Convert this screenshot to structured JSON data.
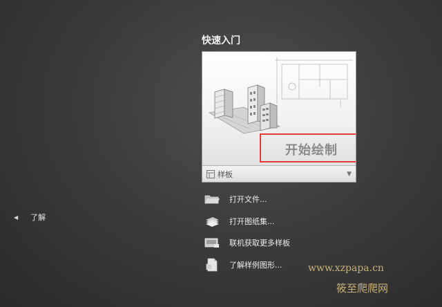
{
  "quick_start": {
    "title": "快速入门",
    "start_drawing": "开始绘制",
    "template_label": "样板",
    "template_icon": "template-icon",
    "dropdown_icon": "dropdown-arrow-icon"
  },
  "actions": [
    {
      "label": "打开文件...",
      "icon": "open-folder-icon"
    },
    {
      "label": "打开图纸集...",
      "icon": "sheet-set-icon"
    },
    {
      "label": "联机获取更多样板",
      "icon": "online-templates-icon"
    },
    {
      "label": "了解样例图形...",
      "icon": "sample-drawing-icon"
    }
  ],
  "learn": {
    "label": "了解",
    "icon": "left-arrow-icon"
  },
  "watermark": {
    "url": "www.xzpapa.cn",
    "name": "筱至爬爬网"
  },
  "colors": {
    "highlight": "#e23b3b",
    "watermark": "#c9b27a",
    "background": "#3c3c3c"
  }
}
